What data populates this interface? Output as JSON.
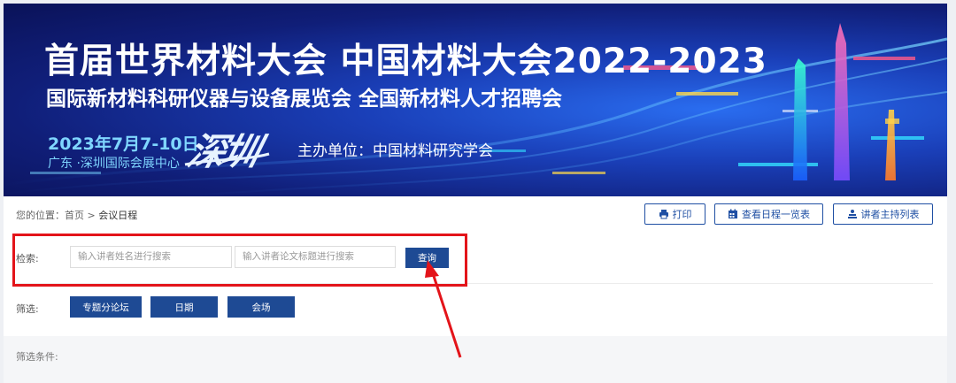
{
  "banner": {
    "title": "首届世界材料大会 中国材料大会2022-2023",
    "subtitle": "国际新材料科研仪器与设备展览会 全国新材料人才招聘会",
    "date": "2023年7月7-10日",
    "venue": "广东 ·深圳国际会展中心",
    "city": "深圳",
    "host": "主办单位：中国材料研究学会"
  },
  "breadcrumb": {
    "prefix": "您的位置：",
    "home": "首页",
    "separator": ">",
    "current": "会议日程"
  },
  "toolbar": {
    "print_label": "打印",
    "schedule_label": "查看日程一览表",
    "speakers_label": "讲者主持列表"
  },
  "search": {
    "label": "检索:",
    "name_placeholder": "输入讲者姓名进行搜索",
    "title_placeholder": "输入讲者论文标题进行搜索",
    "button_label": "查询"
  },
  "filter": {
    "label": "筛选:",
    "buttons": [
      "专题分论坛",
      "日期",
      "会场"
    ],
    "conditions_label": "筛选条件:"
  },
  "annotation": {
    "highlight_color": "#e3141a"
  }
}
